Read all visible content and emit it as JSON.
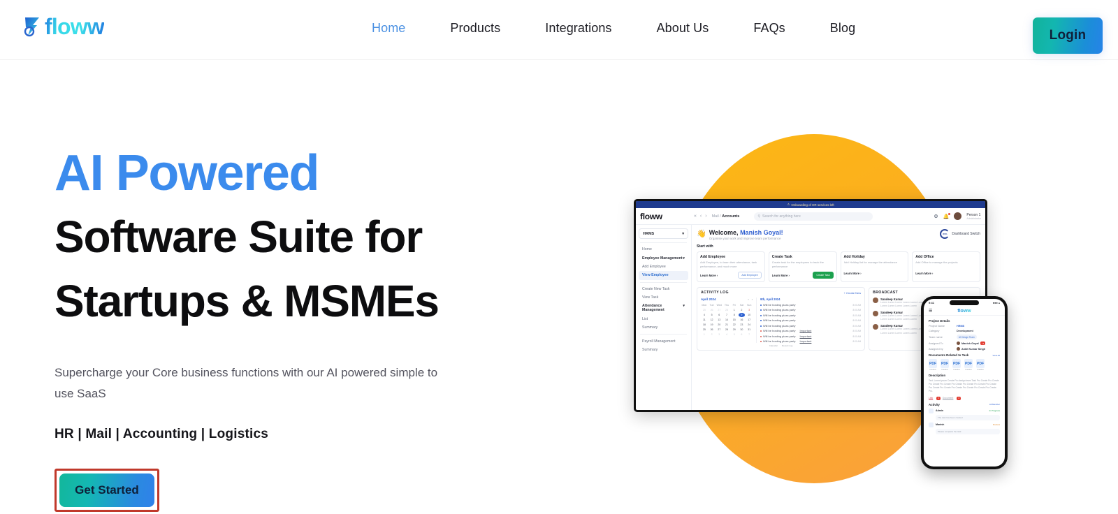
{
  "header": {
    "logo_text": "floww",
    "logo_icon": "floww-mark-icon",
    "nav": [
      {
        "label": "Home",
        "active": true
      },
      {
        "label": "Products",
        "active": false
      },
      {
        "label": "Integrations",
        "active": false
      },
      {
        "label": "About Us",
        "active": false
      },
      {
        "label": "FAQs",
        "active": false
      },
      {
        "label": "Blog",
        "active": false
      }
    ],
    "login_label": "Login"
  },
  "hero": {
    "headline_accent": "AI Powered",
    "headline_line2": "Software Suite for",
    "headline_line3": "Startups & MSMEs",
    "subtitle": "Supercharge your Core business functions with our AI powered simple to use SaaS",
    "features": "HR | Mail | Accounting | Logistics",
    "cta_label": "Get Started",
    "accent_color": "#3b8bed",
    "highlight_color": "#c0392b",
    "circle_color": "#fdb813"
  },
  "dashboard": {
    "banner": "Onboarding of HR services left",
    "logo": "floww",
    "breadcrumb_parent": "Mail /",
    "breadcrumb_current": "Accounts",
    "search_placeholder": "Search for anything here",
    "user_name": "Person 1",
    "user_role": "Administrator",
    "workspace": "HRMS",
    "sidebar": [
      {
        "label": "Home",
        "group": false,
        "active": false
      },
      {
        "label": "Employee Management",
        "group": true,
        "active": false
      },
      {
        "label": "Add Employee",
        "group": false,
        "active": false
      },
      {
        "label": "View Employee",
        "group": false,
        "active": true
      },
      {
        "label": "Create New Task",
        "group": false,
        "active": false
      },
      {
        "label": "View Task",
        "group": false,
        "active": false
      },
      {
        "label": "Attendance Management",
        "group": true,
        "active": false
      },
      {
        "label": "List",
        "group": false,
        "active": false
      },
      {
        "label": "Summary",
        "group": false,
        "active": false
      },
      {
        "label": "Payroll Management",
        "group": false,
        "active": false
      },
      {
        "label": "Summary",
        "group": false,
        "active": false
      }
    ],
    "welcome_prefix": "Welcome, ",
    "welcome_name": "Manish Goyal!",
    "welcome_sub": "Organise your work and improve team performance",
    "dashboard_switch": "Dashboard Switch",
    "ring_label": "80%",
    "start_with": "Start with",
    "cards": [
      {
        "title": "Add Employee",
        "desc": "Add Employee, to learn their attendance, task performance, and much more",
        "link": "Learn More",
        "action": "Add Employee",
        "green": false
      },
      {
        "title": "Create Task",
        "desc": "Create task for the employees to track the performance",
        "link": "Learn More",
        "action": "Create Task",
        "green": true
      },
      {
        "title": "Add Holiday",
        "desc": "Add Holiday list for manage the attendance",
        "link": "Learn More",
        "action": "",
        "green": false
      },
      {
        "title": "Add Office",
        "desc": "Add Office to manage the projects",
        "link": "Learn More",
        "action": "",
        "green": false
      }
    ],
    "activity_title": "ACTIVITY LOG",
    "activity_create": "Create New",
    "calendar_month": "April 2024",
    "calendar_daynames": [
      "Mon",
      "Tue",
      "Wed",
      "Thu",
      "Fri",
      "Sat",
      "Sun"
    ],
    "calendar_weeks": [
      [
        {
          "d": "25",
          "mut": true
        },
        {
          "d": "26",
          "mut": true
        },
        {
          "d": "27",
          "mut": true
        },
        {
          "d": "28",
          "mut": true
        },
        {
          "d": "1"
        },
        {
          "d": "2"
        },
        {
          "d": "3",
          "sun": true
        }
      ],
      [
        {
          "d": "4"
        },
        {
          "d": "5"
        },
        {
          "d": "6"
        },
        {
          "d": "7"
        },
        {
          "d": "8"
        },
        {
          "d": "9",
          "sel": true
        },
        {
          "d": "10"
        }
      ],
      [
        {
          "d": "11"
        },
        {
          "d": "12"
        },
        {
          "d": "13"
        },
        {
          "d": "14"
        },
        {
          "d": "15"
        },
        {
          "d": "16"
        },
        {
          "d": "17"
        }
      ],
      [
        {
          "d": "18"
        },
        {
          "d": "19"
        },
        {
          "d": "20"
        },
        {
          "d": "21"
        },
        {
          "d": "22"
        },
        {
          "d": "23"
        },
        {
          "d": "24"
        }
      ],
      [
        {
          "d": "25"
        },
        {
          "d": "26"
        },
        {
          "d": "27"
        },
        {
          "d": "28"
        },
        {
          "d": "29"
        },
        {
          "d": "30"
        },
        {
          "d": "31"
        }
      ],
      [
        {
          "d": "1",
          "mut": true
        },
        {
          "d": "2",
          "mut": true
        },
        {
          "d": "3",
          "mut": true
        },
        {
          "d": "4",
          "mut": true
        },
        {
          "d": "5",
          "mut": true
        },
        {
          "d": "6",
          "mut": true
        },
        {
          "d": "7",
          "mut": true
        }
      ]
    ],
    "feed_date": "9th, April 2024",
    "feed": [
      {
        "text": "Will be hosting pizza party",
        "time": "8:00 AM",
        "red": false,
        "tag": ""
      },
      {
        "text": "Will be hosting pizza party",
        "time": "8:00 AM",
        "red": false,
        "tag": ""
      },
      {
        "text": "Will be hosting pizza party",
        "time": "8:00 AM",
        "red": false,
        "tag": ""
      },
      {
        "text": "Will be hosting pizza party",
        "time": "8:00 AM",
        "red": false,
        "tag": ""
      },
      {
        "text": "Will be hosting pizza party",
        "time": "8:00 AM",
        "red": false,
        "tag": ""
      },
      {
        "text": "Will be hosting pizza party",
        "time": "8:00 AM",
        "red": true,
        "tag": "Important"
      },
      {
        "text": "Will be hosting pizza party",
        "time": "8:00 AM",
        "red": true,
        "tag": "Important"
      },
      {
        "text": "Will be hosting pizza party",
        "time": "8:00 AM",
        "red": true,
        "tag": "Important"
      }
    ],
    "legend_left": "Calendar",
    "legend_right": "Recent Log",
    "broadcast_title": "BROADCAST",
    "broadcast": [
      {
        "name": "Sandeep Kumar",
        "text": "Lorem Lorem Lorem Lorem Lorem LoremLorem Lorem Lorem Lorem Lorem Lorem m Lorem Lorem Lorem Lorem Lorem"
      },
      {
        "name": "Sandeep Kumar",
        "text": "Lorem Lorem Lorem Lorem Lorem LoremLorem Lorem Lorem Lorem Lorem Lorem m Lorem Lorem Lorem Lorem Lorem"
      },
      {
        "name": "Sandeep Kumar",
        "text": "Lorem Lorem Lorem Lorem Lorem LoremLorem Lorem Lorem Lorem Lorem Lorem m Lorem Lorem Lorem Lorem Lorem"
      }
    ]
  },
  "phone": {
    "status_time": "9:41",
    "logo": "floww",
    "section_title": "Project Details",
    "fields": [
      {
        "label": "Project Name",
        "value": "HRMS",
        "style": "blue"
      },
      {
        "label": "Category",
        "value": "Development",
        "style": "plain"
      },
      {
        "label": "Team name",
        "value": "UI Design Team",
        "style": "chip"
      },
      {
        "label": "Assigned To",
        "value": "Manish Goyal",
        "style": "avatar",
        "badge": "+4"
      },
      {
        "label": "Assigned by",
        "value": "Ankit Kumar Singh",
        "style": "avatar",
        "badge": ""
      }
    ],
    "docs_title": "Documents Related to Task",
    "docs_view_all": "View All",
    "docs": [
      {
        "icon": "PDF",
        "caption": "Creative"
      },
      {
        "icon": "PDF",
        "caption": "Creative"
      },
      {
        "icon": "PDF",
        "caption": "Creative"
      },
      {
        "icon": "PDF",
        "caption": "Creative"
      },
      {
        "icon": "PDF",
        "caption": "Creative"
      }
    ],
    "desc_title": "Description",
    "desc_text": "Text. Lorem ipsum Create Pro design team Task Pro Create Pro Create Pro Create Pro Create Pro Create Pro Create Pro Create Pro Create Pro Create Pro Create Pro Create Pro Create Pro Create Pro Create Pro.",
    "link_1": "Link",
    "link_2": "Document",
    "activity_title": "Activity",
    "activity_all": "All Member",
    "activity": [
      {
        "name": "Admin",
        "status": "In Progress",
        "state": "ok",
        "time": "2 hrs ago",
        "msg": "The task has been created"
      },
      {
        "name": "Manish",
        "status": "Review",
        "state": "warn",
        "time": "1 hr ago",
        "msg": "Please complete the task"
      }
    ]
  }
}
